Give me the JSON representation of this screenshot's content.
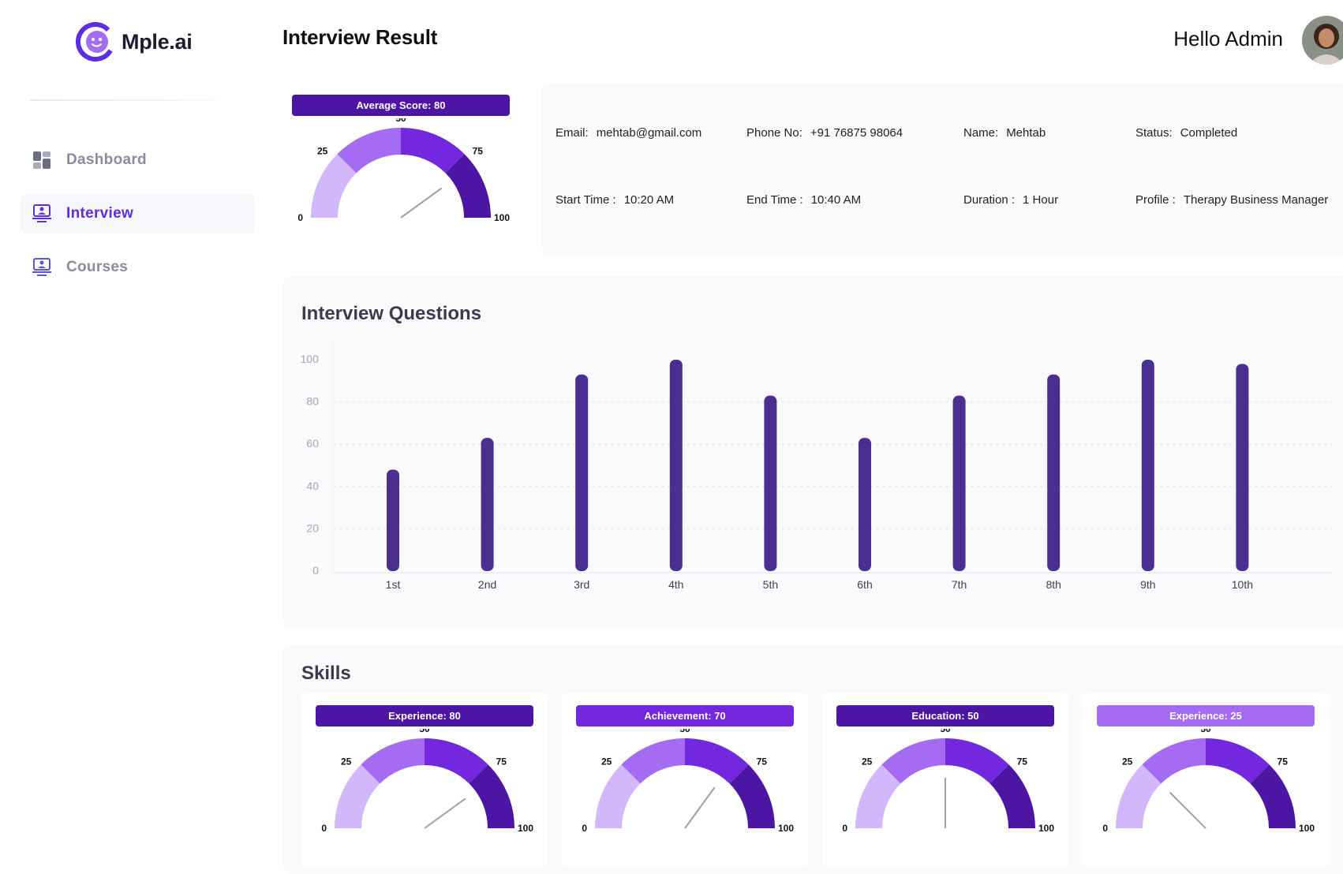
{
  "app": {
    "name": "Mple.ai",
    "page_title": "Interview Result",
    "greeting": "Hello Admin"
  },
  "sidebar": {
    "items": [
      {
        "label": "Dashboard",
        "icon": "dashboard-icon",
        "active": false
      },
      {
        "label": "Interview",
        "icon": "monitor-user-icon",
        "active": true
      },
      {
        "label": "Courses",
        "icon": "monitor-user-icon",
        "active": false
      }
    ]
  },
  "average_gauge": {
    "label": "Average Score: 80",
    "value": 80,
    "color": "#4d15a3",
    "ticks": [
      "0",
      "25",
      "50",
      "75",
      "100"
    ]
  },
  "info": {
    "email": {
      "k": "Email:",
      "v": "mehtab@gmail.com"
    },
    "phone": {
      "k": "Phone No:",
      "v": "+91 76875 98064"
    },
    "name": {
      "k": "Name:",
      "v": "Mehtab"
    },
    "status": {
      "k": "Status:",
      "v": "Completed"
    },
    "start": {
      "k": "Start Time :",
      "v": "10:20 AM"
    },
    "end": {
      "k": "End Time :",
      "v": "10:40 AM"
    },
    "duration": {
      "k": "Duration :",
      "v": "1 Hour"
    },
    "profile": {
      "k": "Profile :",
      "v": "Therapy Business Manager"
    }
  },
  "questions": {
    "title": "Interview Questions"
  },
  "chart_data": {
    "type": "bar",
    "title": "Interview Questions",
    "categories": [
      "1st",
      "2nd",
      "3rd",
      "4th",
      "5th",
      "6th",
      "7th",
      "8th",
      "9th",
      "10th"
    ],
    "values": [
      48,
      63,
      93,
      100,
      83,
      63,
      83,
      93,
      100,
      98
    ],
    "ylim": [
      0,
      100
    ],
    "yticks": [
      0,
      20,
      40,
      60,
      80,
      100
    ],
    "grid": true,
    "bar_color": "#4a2f91"
  },
  "skills": {
    "title": "Skills",
    "items": [
      {
        "label": "Experience: 80",
        "value": 80,
        "color": "#4d15a3"
      },
      {
        "label": "Achievement: 70",
        "value": 70,
        "color": "#7328df"
      },
      {
        "label": "Education: 50",
        "value": 50,
        "color": "#4d15a3"
      },
      {
        "label": "Experience: 25",
        "value": 25,
        "color": "#a56cf3"
      }
    ]
  },
  "colors": {
    "accent": "#5b2ee3",
    "gauge_segments": [
      "#d3b7fb",
      "#a56cf3",
      "#7328df",
      "#4d15a3"
    ]
  }
}
